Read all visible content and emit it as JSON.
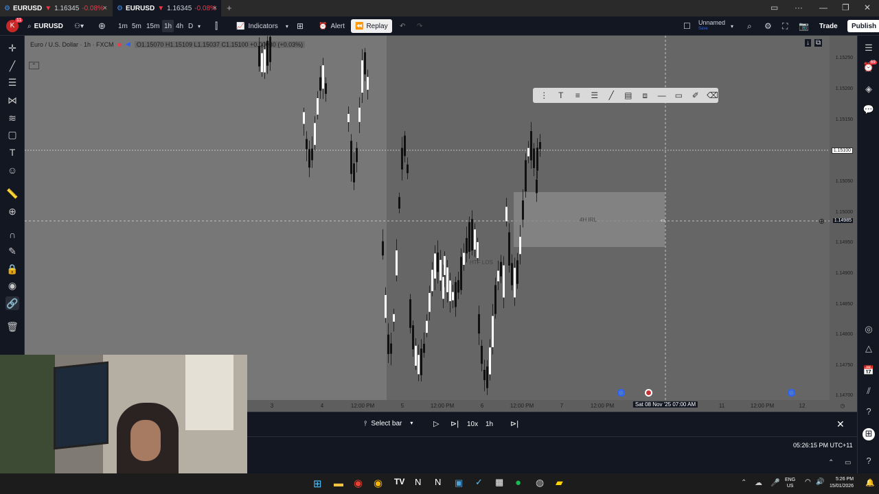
{
  "tabs": [
    {
      "ticker": "EURUSD",
      "price": "1.16345",
      "change": "-0.08%",
      "close": "×"
    },
    {
      "ticker": "EURUSD",
      "price": "1.16345",
      "change": "-0.08%",
      "close": "×"
    }
  ],
  "new_tab": "+",
  "toolbar": {
    "avatar_letter": "K",
    "avatar_badge": "11",
    "symbol": "EURUSD",
    "timeframes": [
      "1m",
      "5m",
      "15m",
      "1h",
      "4h",
      "D"
    ],
    "active_timeframe": "1h",
    "indicators_label": "Indicators",
    "alert_label": "Alert",
    "replay_label": "Replay",
    "layout_name": "Unnamed",
    "layout_sub": "Save",
    "trade_label": "Trade",
    "publish_label": "Publish"
  },
  "legend": {
    "title": "Euro / U.S. Dollar · 1h · FXCM",
    "ohlc": "O1.15070 H1.15109 L1.15037 C1.15100 +0.00030 (+0.03%)"
  },
  "price_ticks": [
    "1.15250",
    "1.15200",
    "1.15150",
    "1.15100",
    "1.15050",
    "1.15000",
    "1.14985",
    "1.14950",
    "1.14900",
    "1.14850",
    "1.14800",
    "1.14750",
    "1.14700"
  ],
  "current_price_label": "1.15100",
  "crosshair_price_label": "1.14985",
  "time_ticks": [
    "3",
    "4",
    "12:00 PM",
    "5",
    "12:00 PM",
    "6",
    "12:00 PM",
    "7",
    "12:00 PM",
    "Sat 08 Nov '25   07:00 AM",
    "11",
    "12:00 PM",
    "12"
  ],
  "zone_label": "4H IRL",
  "level_label": "HTF LOS",
  "replay": {
    "select_bar": "Select bar",
    "speed": "10x",
    "interval": "1h"
  },
  "status": {
    "clock": "05:26:15 PM UTC+11"
  },
  "taskbar": {
    "lang": "ENG",
    "region": "US",
    "time": "5:26 PM",
    "date": "15/01/2026"
  },
  "right_badge": "69"
}
